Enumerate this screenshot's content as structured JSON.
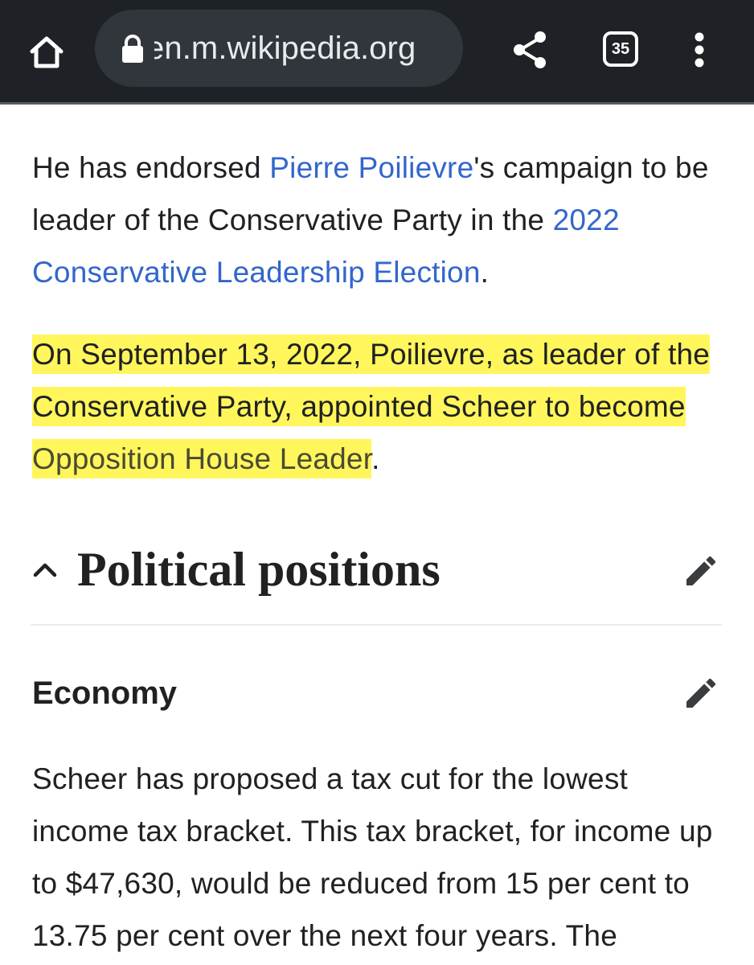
{
  "browser": {
    "url": "en.m.wikipedia.org",
    "tab_count": "35"
  },
  "article": {
    "para1": {
      "t1": "He has endorsed ",
      "link1": "Pierre Poilievre",
      "t2": "'s campaign to be leader of the Conservative Party in the ",
      "link2": "2022 Conservative Leadership Election",
      "t3": "."
    },
    "para2": {
      "t1": "On September 13, 2022, Poilievre, as leader of the Conservative Party, appointed Scheer to become ",
      "link1": "Opposition House Leader",
      "t2": ".",
      "highlight_color": "#fff65c"
    },
    "section": {
      "title": "Political positions"
    },
    "subsection": {
      "title": "Economy"
    },
    "para3": {
      "text": "Scheer has proposed a tax cut for the lowest income tax bracket. This tax bracket, for income up to $47,630, would be reduced from 15 per cent to 13.75 per cent over the next four years. The"
    }
  },
  "colors": {
    "toolbar_bg": "#1e2226",
    "url_bar_bg": "#30363c",
    "link": "#3366cc",
    "text": "#202122",
    "highlight": "#fff65c"
  },
  "icons": [
    "home-icon",
    "lock-icon",
    "share-icon",
    "tabs-icon",
    "more-vert-icon",
    "chevron-up-icon",
    "pencil-icon"
  ]
}
